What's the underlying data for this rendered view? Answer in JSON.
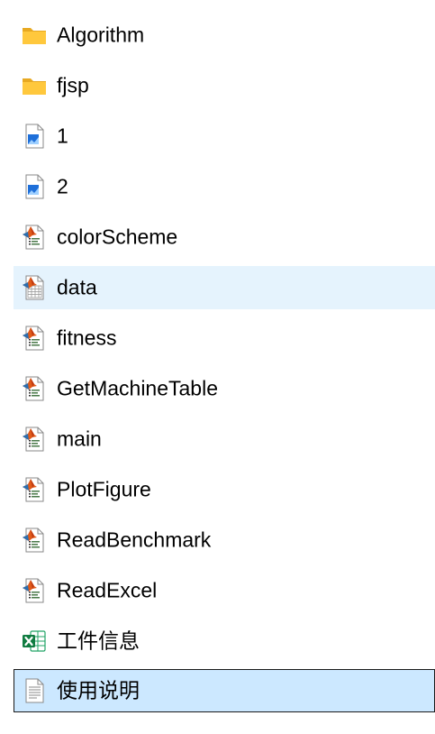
{
  "files": [
    {
      "name": "Algorithm",
      "type": "folder-icon"
    },
    {
      "name": "fjsp",
      "type": "folder-icon"
    },
    {
      "name": "1",
      "type": "image-file-icon"
    },
    {
      "name": "2",
      "type": "image-file-icon"
    },
    {
      "name": "colorScheme",
      "type": "matlab-file-icon"
    },
    {
      "name": "data",
      "type": "matlab-data-file-icon",
      "state": "hover"
    },
    {
      "name": "fitness",
      "type": "matlab-file-icon"
    },
    {
      "name": "GetMachineTable",
      "type": "matlab-file-icon"
    },
    {
      "name": "main",
      "type": "matlab-file-icon"
    },
    {
      "name": "PlotFigure",
      "type": "matlab-file-icon"
    },
    {
      "name": "ReadBenchmark",
      "type": "matlab-file-icon"
    },
    {
      "name": "ReadExcel",
      "type": "matlab-file-icon"
    },
    {
      "name": "工件信息",
      "type": "excel-file-icon"
    },
    {
      "name": "使用说明",
      "type": "text-file-icon",
      "state": "selected"
    }
  ],
  "colors": {
    "hover_bg": "#e5f3fd",
    "selected_bg": "#cce8ff",
    "folder": "#ffc83d",
    "excel": "#107c41",
    "image_blue": "#1e6fd9"
  }
}
